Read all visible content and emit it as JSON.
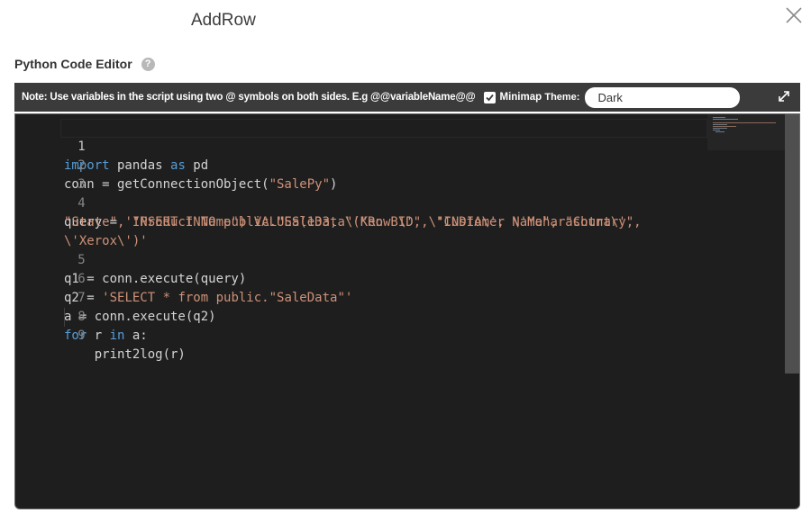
{
  "dialog": {
    "title": "AddRow"
  },
  "section": {
    "label": "Python Code Editor",
    "help_icon": "?"
  },
  "toolbar": {
    "note": "Note: Use variables in the script using two @ symbols on both sides. E.g @@variableName@@",
    "minimap_checked": true,
    "minimap_label": "Minimap",
    "theme_label": "Theme:",
    "theme_value": "Dark"
  },
  "editor": {
    "line_numbers": [
      "1",
      "2",
      "3",
      "4",
      "5",
      "6",
      "7",
      "8",
      "9"
    ],
    "lines": [
      "import pandas as pd",
      "conn = getConnectionObject(\"SalePy\")",
      "",
      "query = 'INSERT INTO public.\"SaleData\"(\"Row ID\", \"Customer Name\", \"Country\",",
      "\"State\", \"Product Name\") VALUES(133, \\'Ken B\\', \\'INDIA\\', \\'Maharashtra\\',",
      "\\'Xerox\\')'",
      "q1 = conn.execute(query)",
      "q2 = 'SELECT * from public.\"SaleData\"'",
      "a = conn.execute(q2)",
      "for r in a:",
      "    print2log(r)"
    ]
  },
  "colors": {
    "editor_bg": "#1e1e1e",
    "keyword": "#569cd6",
    "string": "#ce9178",
    "toolbar_bg": "#3b3b3b"
  }
}
